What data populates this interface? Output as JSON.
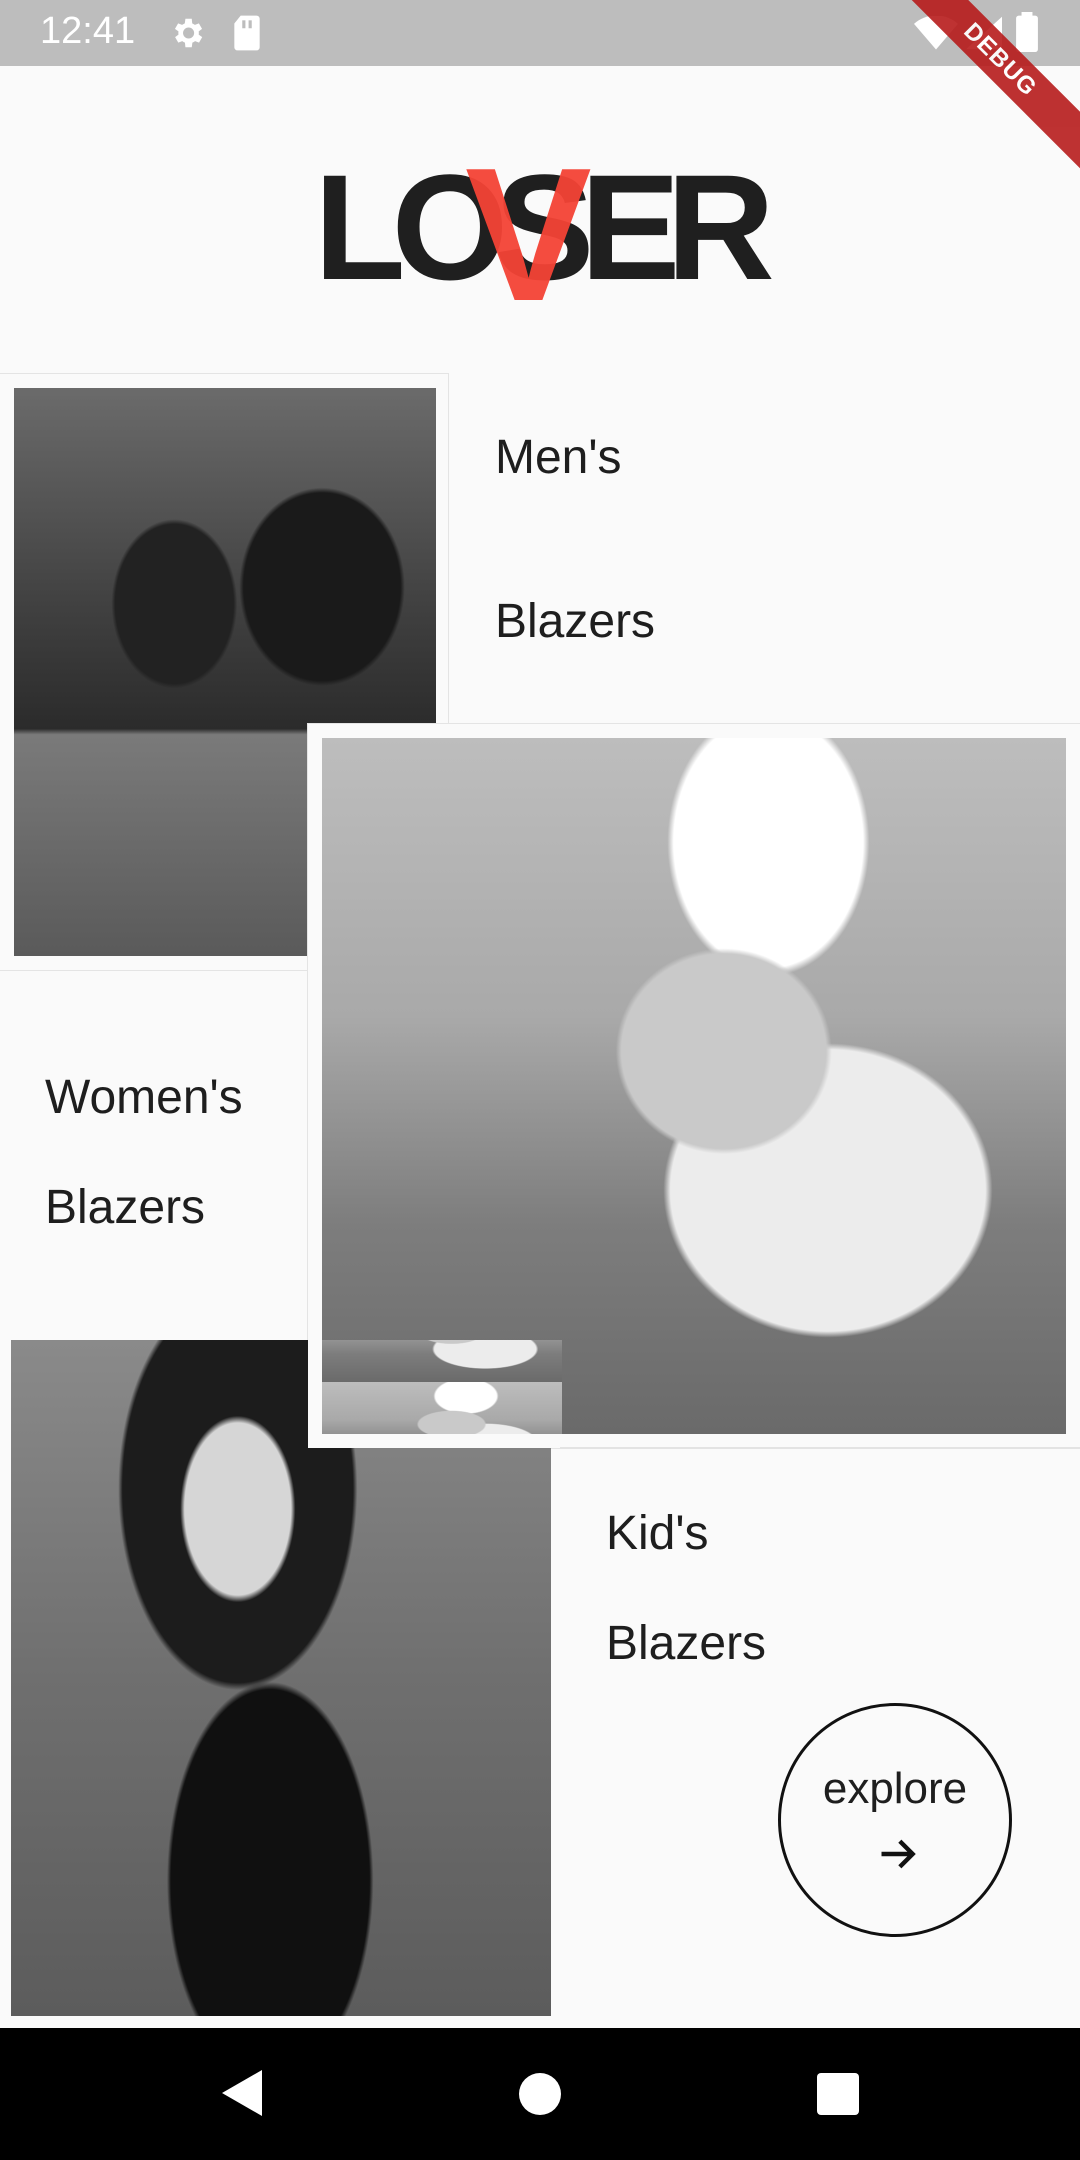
{
  "status_bar": {
    "time": "12:41",
    "icons": [
      "gear-icon",
      "sd-card-icon",
      "wifi-icon",
      "cellular-icon",
      "battery-icon"
    ],
    "debug_banner": "DEBUG"
  },
  "logo": {
    "word": "LOSER",
    "accent_letter": "V",
    "accent_color": "#f44336",
    "text_color": "#1f1f1f"
  },
  "categories": [
    {
      "line1": "Men's",
      "line2": "Blazers"
    },
    {
      "line1": "Women's",
      "line2": "Blazers"
    },
    {
      "line1": "Kid's",
      "line2": "Blazers"
    }
  ],
  "explore_button": {
    "label": "explore",
    "icon": "arrow-right-icon"
  },
  "nav_bar": {
    "buttons": [
      "back-icon",
      "home-icon",
      "recents-icon"
    ]
  }
}
